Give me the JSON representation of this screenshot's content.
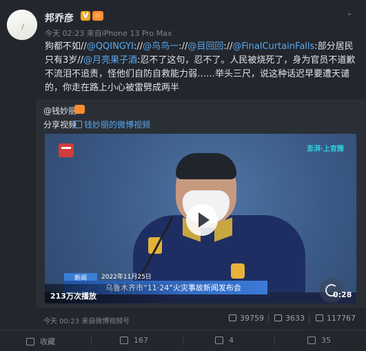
{
  "post": {
    "author": "邦乔彦",
    "verified_badge": "V",
    "time": "今天 02:23",
    "source_prefix": "来自",
    "source": "iPhone 13 Pro Max",
    "text_1": "狗都不如//",
    "mention_1": "@QQINGYI",
    "sep_1": ":",
    "sep_2": "//",
    "mention_2": "@鸟鸟一",
    "sep_3": ":",
    "sep_4": "//",
    "mention_3": "@目回回",
    "sep_5": ":",
    "sep_6": "//",
    "mention_4": "@FinalCurtainFalls",
    "text_2": ":部分居民只有3岁//",
    "mention_5": "@月亮果子酒",
    "text_3": ":忍不了这句，忍不了。人民被烧死了，身为官员不道歉不流泪不追责，怪他们自防自救能力弱……举头三尺，说这种话迟早要遭天谴的，你走在路上小心被雷劈成两半"
  },
  "retweet": {
    "author": "@钱妙丽",
    "share_label": "分享视频",
    "link_label": "钱妙丽的微博视频",
    "video": {
      "views": "213万次播放",
      "duration": "0:28",
      "news_tag": "新闻",
      "date_caption": "2022年11月25日",
      "lower_title": "乌鲁木齐市“11·24”火灾事故新闻发布会",
      "watermark_right": "澎湃·上官腾"
    },
    "footer_time": "今天 00:23",
    "footer_source": "来自微博视频号",
    "reposts": "39759",
    "comments": "3633",
    "likes": "117767"
  },
  "actions": {
    "favorite": "收藏",
    "repost": "167",
    "comment": "4",
    "like": "35"
  },
  "colors": {
    "link": "#5aa8ef",
    "background": "#23272d",
    "retweet_bg": "#2a2f36"
  }
}
